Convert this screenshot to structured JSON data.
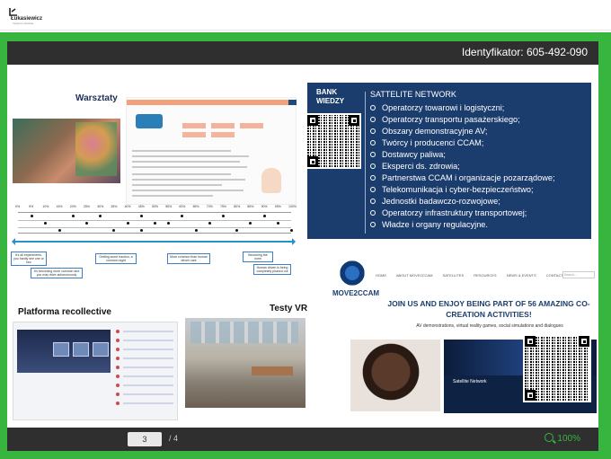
{
  "app": {
    "logo_text": "Łukasiewicz",
    "logo_sub": "Instytut Lotnictwa"
  },
  "viewer": {
    "identifier": "Identyfikator: 605-492-090",
    "current_page": "3",
    "total_pages": "/ 4",
    "zoom": "100%",
    "accent_color": "#37b53f"
  },
  "slide": {
    "workshops_heading": "Warsztaty",
    "recollective_heading": "Platforma recollective",
    "vr_heading": "Testy VR",
    "bank": {
      "title_line1": "BANK",
      "title_line2": "WIEDZY",
      "network_title": "SATTELITE NETWORK",
      "items": [
        "Operatorzy towarowi i logistyczni;",
        "Operatorzy transportu pasażerskiego;",
        "Obszary demonstracyjne AV;",
        "Twórcy i producenci CCAM;",
        "Dostawcy paliwa;",
        "Eksperci ds. zdrowia;",
        "Partnerstwa CCAM i organizacje pozarządowe;",
        "Telekomunikacja i cyber-bezpieczeństwo;",
        "Jednostki badawczo-rozwojowe;",
        "Operatorzy infrastruktury transportowej;",
        "Władze i organy regulacyjne."
      ]
    },
    "move": {
      "wordmark": "MOVE2CCAM",
      "nav": [
        "HOME",
        "ABOUT MOVE2CCAM",
        "SATELLITES",
        "RESOURCES",
        "NEWS & EVENTS",
        "CONTACT"
      ],
      "search_placeholder": "Search...",
      "headline": "JOIN US AND ENJOY BEING PART OF 56 AMAZING CO-CREATION ACTIVITIES!",
      "subline": "AV demonstrations, virtual reality games, social simulations and dialogues",
      "card_title": "Satellite Network"
    },
    "timeline": {
      "percent_labels": [
        "0%",
        "5%",
        "10%",
        "15%",
        "20%",
        "25%",
        "30%",
        "35%",
        "40%",
        "45%",
        "50%",
        "55%",
        "60%",
        "65%",
        "70%",
        "75%",
        "80%",
        "85%",
        "90%",
        "95%",
        "100%"
      ],
      "notes": [
        "It's all experiments, you hardly see one or two",
        "It's becoming more common and you may drive autonomously",
        "Getting some traction, a common sight",
        "More common than human driven cars",
        "Becoming the norm",
        "Human driven is being completely phased out"
      ]
    }
  }
}
